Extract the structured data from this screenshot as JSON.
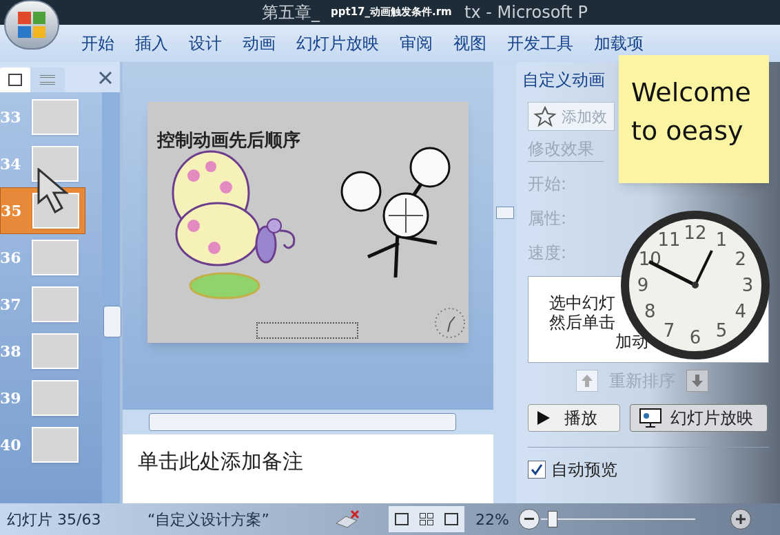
{
  "window": {
    "title_parts": [
      "第五章_",
      "tx - Microsoft P"
    ],
    "video_title": "ppt17_动画触发条件.rm"
  },
  "ribbon_tabs": [
    {
      "label": "开始",
      "selected": false
    },
    {
      "label": "插入",
      "selected": false
    },
    {
      "label": "设计",
      "selected": false
    },
    {
      "label": "动画",
      "selected": false
    },
    {
      "label": "幻灯片放映",
      "selected": false
    },
    {
      "label": "审阅",
      "selected": false
    },
    {
      "label": "视图",
      "selected": false
    },
    {
      "label": "开发工具",
      "selected": false
    },
    {
      "label": "加载项",
      "selected": false
    }
  ],
  "thumbnails": [
    {
      "number": "33",
      "selected": false
    },
    {
      "number": "34",
      "selected": false
    },
    {
      "number": "35",
      "selected": true
    },
    {
      "number": "36",
      "selected": false
    },
    {
      "number": "37",
      "selected": false
    },
    {
      "number": "38",
      "selected": false
    },
    {
      "number": "39",
      "selected": false
    },
    {
      "number": "40",
      "selected": false
    }
  ],
  "slide": {
    "title": "控制动画先后顺序"
  },
  "notes": {
    "placeholder": "单击此处添加备注"
  },
  "task_pane": {
    "title": "自定义动画",
    "add_effect": "添加效",
    "modify_heading": "修改效果",
    "fields": [
      "开始:",
      "属性:",
      "速度:"
    ],
    "hint_lines": [
      "选中幻灯",
      "然后单击",
      "加动"
    ],
    "reorder": "重新排序",
    "play": "播放",
    "slideshow": "幻灯片放映",
    "auto_preview": {
      "label": "自动预览",
      "checked": true
    }
  },
  "sticky_note": {
    "text": "Welcome to oeasy"
  },
  "clock": {
    "numerals": [
      "11",
      "12",
      "1",
      "10",
      "2",
      "9",
      "3",
      "8",
      "4",
      "7",
      "6",
      "5"
    ]
  },
  "status_bar": {
    "slide_count": "幻灯片 35/63",
    "theme": "“自定义设计方案”",
    "zoom": "22%",
    "zoom_slider": {
      "level": 0.05
    }
  }
}
